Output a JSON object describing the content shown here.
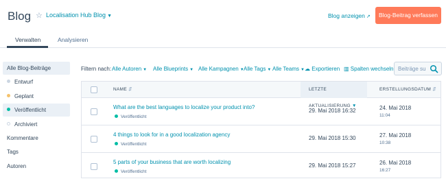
{
  "header": {
    "title": "Blog",
    "blog_name": "Localisation Hub Blog",
    "view_blog": "Blog anzeigen",
    "write_post": "Blog-Beitrag verfassen"
  },
  "tabs": [
    {
      "label": "Verwalten",
      "active": true
    },
    {
      "label": "Analysieren",
      "active": false
    }
  ],
  "sidebar": {
    "items": [
      {
        "label": "Alle Blog-Beiträge",
        "active": true
      },
      {
        "label": "Entwurf",
        "dot_color": "#cbd6e2"
      },
      {
        "label": "Geplant",
        "dot_color": "#f5c26b"
      },
      {
        "label": "Veröffentlicht",
        "dot_color": "#00bda5"
      },
      {
        "label": "Archiviert",
        "dot_color": "#ffffff"
      },
      {
        "label": "Kommentare"
      },
      {
        "label": "Tags"
      },
      {
        "label": "Autoren"
      }
    ]
  },
  "filters": {
    "label": "Filtern nach:",
    "authors": "Alle Autoren",
    "blueprints": "Alle Blueprints",
    "campaigns": "Alle Kampagnen",
    "tags": "Alle Tags",
    "teams": "Alle Teams",
    "export": "Exportieren",
    "columns": "Spalten wechseln",
    "search_placeholder": "Beiträge su"
  },
  "table": {
    "columns": {
      "name": "NAME",
      "updated": "LETZTE AKTUALISIERUNG",
      "created": "ERSTELLUNGSDATUM"
    },
    "rows": [
      {
        "title": "What are the best languages to localize your product into?",
        "status": "Veröffentlicht",
        "updated": "29. Mai 2018 16:32",
        "created_date": "24. Mai 2018",
        "created_time": "11:04"
      },
      {
        "title": "4 things to look for in a good localization agency",
        "status": "Veröffentlicht",
        "updated": "29. Mai 2018 15:30",
        "created_date": "27. Mai 2018",
        "created_time": "10:38"
      },
      {
        "title": "5 parts of your business that are worth localizing",
        "status": "Veröffentlicht",
        "updated": "29. Mai 2018 15:27",
        "created_date": "26. Mai 2018",
        "created_time": "16:27"
      }
    ]
  },
  "colors": {
    "accent": "#0091ae",
    "primary_button": "#ff7a59",
    "published": "#00bda5",
    "text": "#33475b"
  }
}
